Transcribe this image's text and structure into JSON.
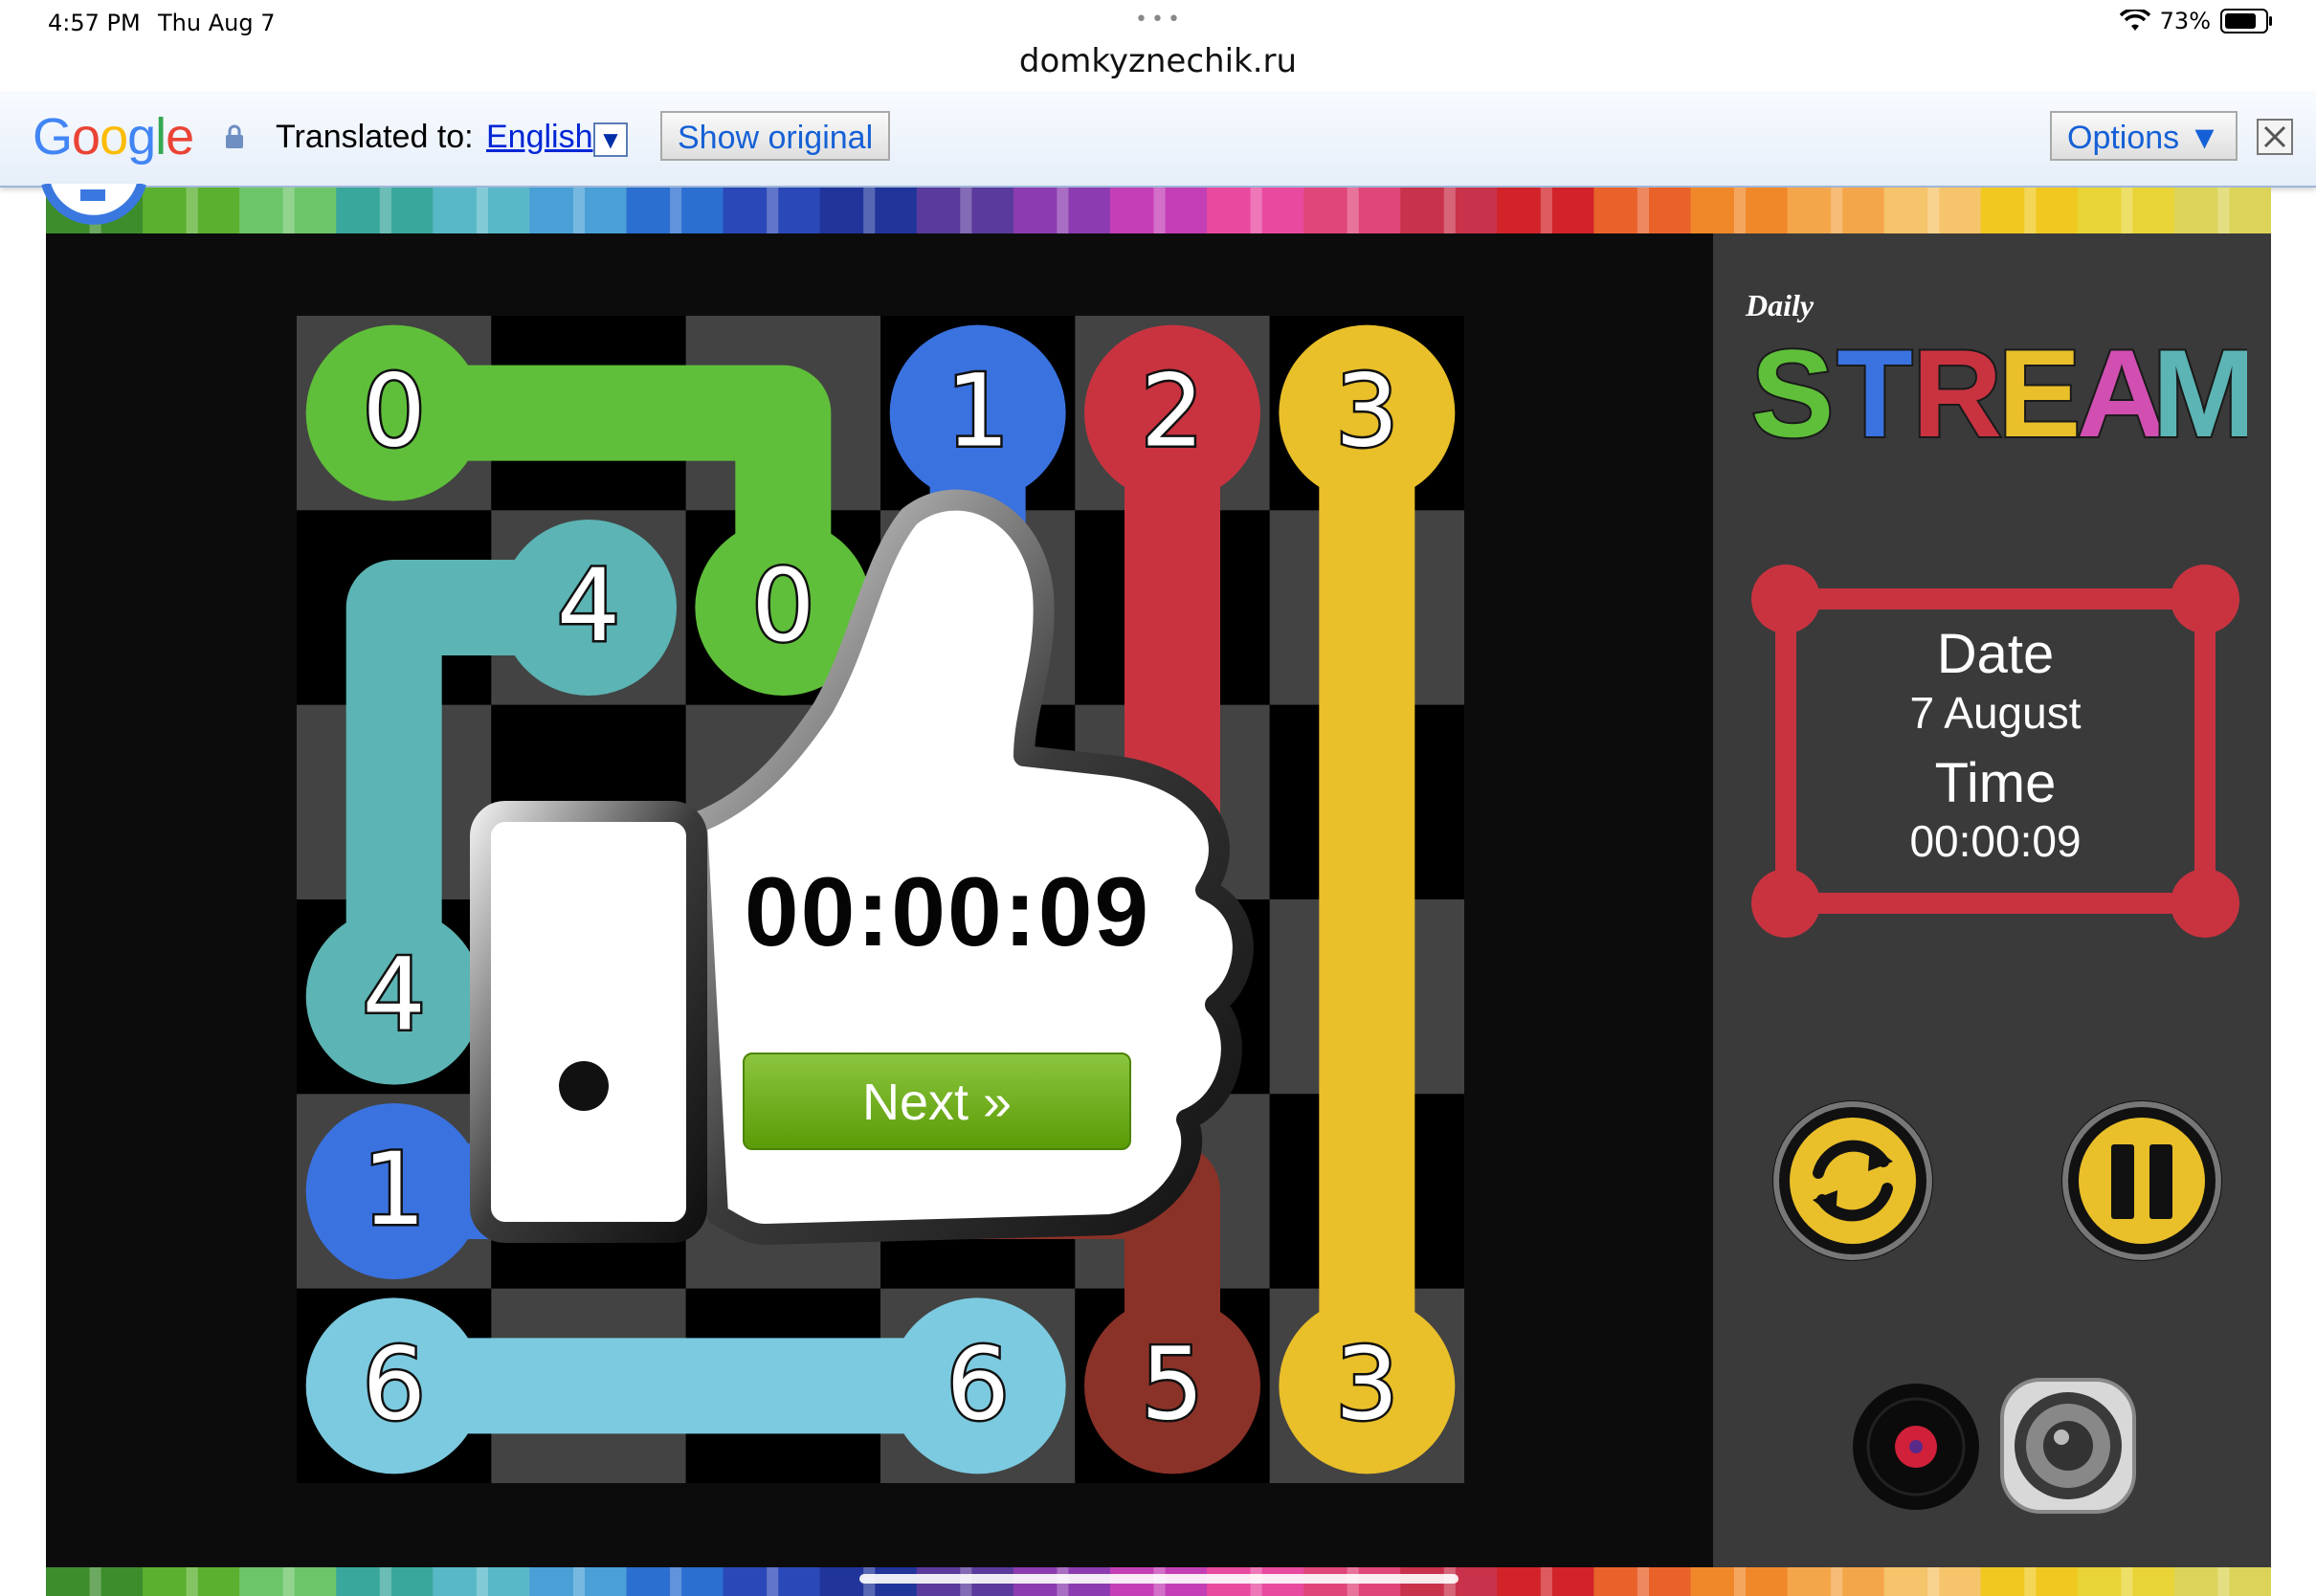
{
  "status_bar": {
    "time": "4:57 PM",
    "date": "Thu Aug 7",
    "battery": "73%"
  },
  "browser": {
    "url": "domkyznechik.ru"
  },
  "translate_bar": {
    "logo": "Google",
    "translated_to_label": "Translated to:",
    "language": "English",
    "show_original_label": "Show original",
    "options_label": "Options ▼"
  },
  "game": {
    "title_small": "Daily",
    "title_big": "STREAM",
    "date_label": "Date",
    "date_value": "7 August",
    "time_label": "Time",
    "time_value": "00:00:09",
    "result_time": "00:00:09",
    "next_label": "Next »",
    "grid_size": 6,
    "colors": {
      "green": "#5fbf3a",
      "teal": "#5cb4b4",
      "blue": "#3a72e0",
      "red": "#c93340",
      "yellow": "#e9bf2a",
      "skyblue": "#7ccae0",
      "brown": "#8b3228"
    },
    "endpoints": [
      {
        "label": "0",
        "row": 0,
        "col": 0,
        "color": "green"
      },
      {
        "label": "0",
        "row": 1,
        "col": 2,
        "color": "green"
      },
      {
        "label": "1",
        "row": 0,
        "col": 3,
        "color": "blue"
      },
      {
        "label": "1",
        "row": 4,
        "col": 0,
        "color": "blue"
      },
      {
        "label": "2",
        "row": 0,
        "col": 4,
        "color": "red"
      },
      {
        "label": "3",
        "row": 0,
        "col": 5,
        "color": "yellow"
      },
      {
        "label": "3",
        "row": 5,
        "col": 5,
        "color": "yellow"
      },
      {
        "label": "4",
        "row": 1,
        "col": 1,
        "color": "teal"
      },
      {
        "label": "4",
        "row": 3,
        "col": 0,
        "color": "teal"
      },
      {
        "label": "5",
        "row": 5,
        "col": 4,
        "color": "brown"
      },
      {
        "label": "6",
        "row": 5,
        "col": 0,
        "color": "skyblue"
      },
      {
        "label": "6",
        "row": 5,
        "col": 3,
        "color": "skyblue"
      }
    ]
  }
}
